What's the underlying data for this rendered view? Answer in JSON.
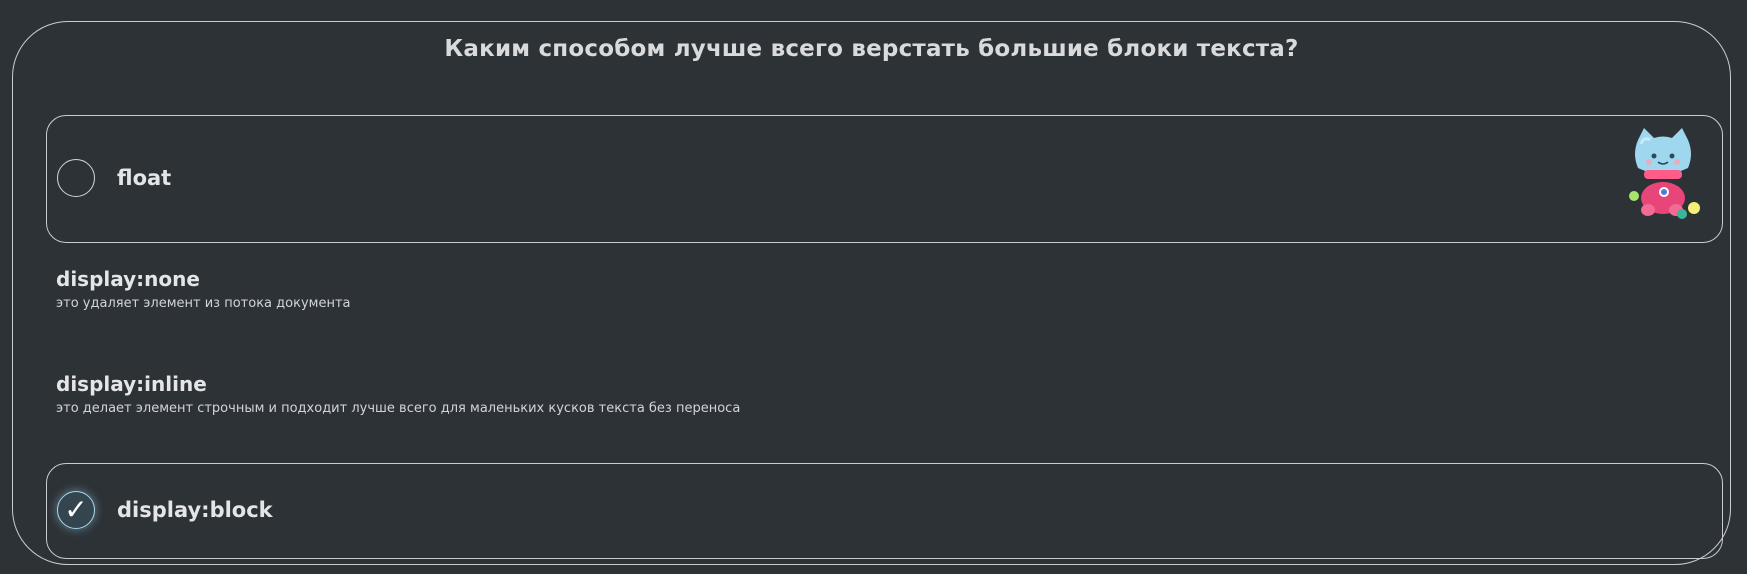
{
  "quiz": {
    "question": "Каким способом лучше всего верстать большие блоки текста?",
    "options": [
      {
        "label": "float",
        "state": "unselected"
      },
      {
        "label": "display:none",
        "explanation": "это удаляет элемент из потока документа"
      },
      {
        "label": "display:inline",
        "explanation": "это делает элемент строчным и подходит лучше всего для маленьких кусков текста без переноса"
      },
      {
        "label": "display:block",
        "state": "selected",
        "check_glyph": "✓"
      }
    ],
    "mascot": {
      "icon": "cat-mascot-icon"
    }
  },
  "colors": {
    "background": "#2d3237",
    "border": "#c9ccd0",
    "text": "#e4e5e7",
    "selected_glow": "#a9d6ea"
  }
}
